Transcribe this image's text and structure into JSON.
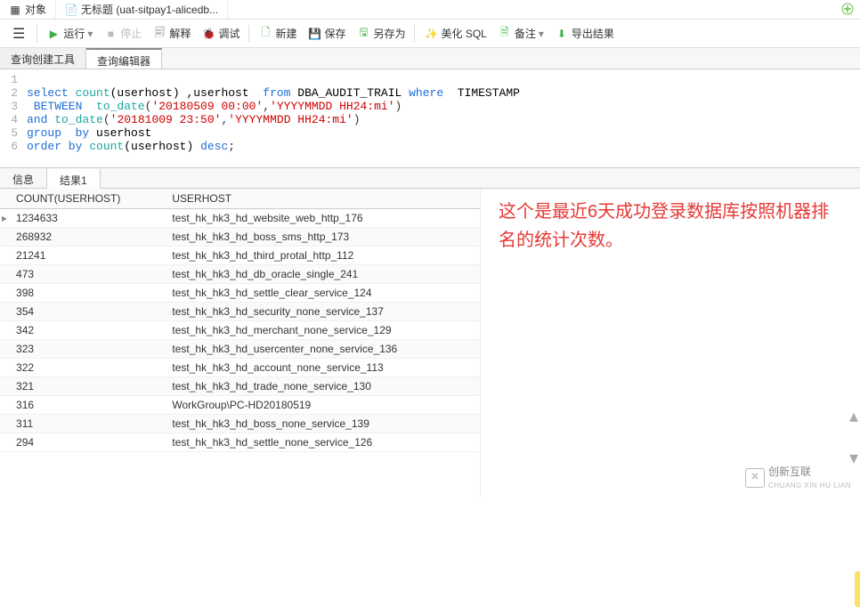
{
  "title_tabs": {
    "object": "对象",
    "untitled": "无标题 (uat-sitpay1-alicedb..."
  },
  "toolbar": {
    "run": "运行",
    "stop": "停止",
    "explain": "解释",
    "debug": "调试",
    "new": "新建",
    "save": "保存",
    "saveas": "另存为",
    "beautify": "美化 SQL",
    "comment": "备注",
    "export": "导出结果"
  },
  "secondary_tabs": {
    "query_builder": "查询创建工具",
    "query_editor": "查询编辑器"
  },
  "sql": {
    "l1": "",
    "l2_a": "select",
    "l2_b": " count",
    "l2_c": "(userhost) ,userhost  ",
    "l2_d": "from",
    "l2_e": " DBA_AUDIT_TRAIL ",
    "l2_f": "where",
    "l2_g": "  TIMESTAMP",
    "l3_a": " BETWEEN  ",
    "l3_b": "to_date",
    "l3_c": "(",
    "l3_d": "'20180509 00:00'",
    "l3_e": ",",
    "l3_f": "'YYYYMMDD HH24:mi'",
    "l3_g": ")",
    "l4_a": "and",
    "l4_b": " to_date",
    "l4_c": "(",
    "l4_d": "'20181009 23:50'",
    "l4_e": ",",
    "l4_f": "'YYYYMMDD HH24:mi'",
    "l4_g": ")",
    "l5_a": "group  by",
    "l5_b": " userhost",
    "l6_a": "order by",
    "l6_b": " count",
    "l6_c": "(userhost) ",
    "l6_d": "desc",
    "l6_e": ";"
  },
  "result_tabs": {
    "info": "信息",
    "result1": "结果1"
  },
  "columns": {
    "count": "COUNT(USERHOST)",
    "userhost": "USERHOST"
  },
  "rows": [
    {
      "c": "1234633",
      "u": "test_hk_hk3_hd_website_web_http_176"
    },
    {
      "c": "268932",
      "u": "test_hk_hk3_hd_boss_sms_http_173"
    },
    {
      "c": "21241",
      "u": "test_hk_hk3_hd_third_protal_http_112"
    },
    {
      "c": "473",
      "u": "test_hk_hk3_hd_db_oracle_single_241"
    },
    {
      "c": "398",
      "u": "test_hk_hk3_hd_settle_clear_service_124"
    },
    {
      "c": "354",
      "u": "test_hk_hk3_hd_security_none_service_137"
    },
    {
      "c": "342",
      "u": "test_hk_hk3_hd_merchant_none_service_129"
    },
    {
      "c": "323",
      "u": "test_hk_hk3_hd_usercenter_none_service_136"
    },
    {
      "c": "322",
      "u": "test_hk_hk3_hd_account_none_service_113"
    },
    {
      "c": "321",
      "u": "test_hk_hk3_hd_trade_none_service_130"
    },
    {
      "c": "316",
      "u": "WorkGroup\\PC-HD20180519"
    },
    {
      "c": "311",
      "u": "test_hk_hk3_hd_boss_none_service_139"
    },
    {
      "c": "294",
      "u": "test_hk_hk3_hd_settle_none_service_126"
    }
  ],
  "annotation": "这个是最近6天成功登录数据库按照机器排名的统计次数。",
  "watermark_text": "创新互联",
  "watermark_sub": "CHUANG XIN HU LIAN"
}
